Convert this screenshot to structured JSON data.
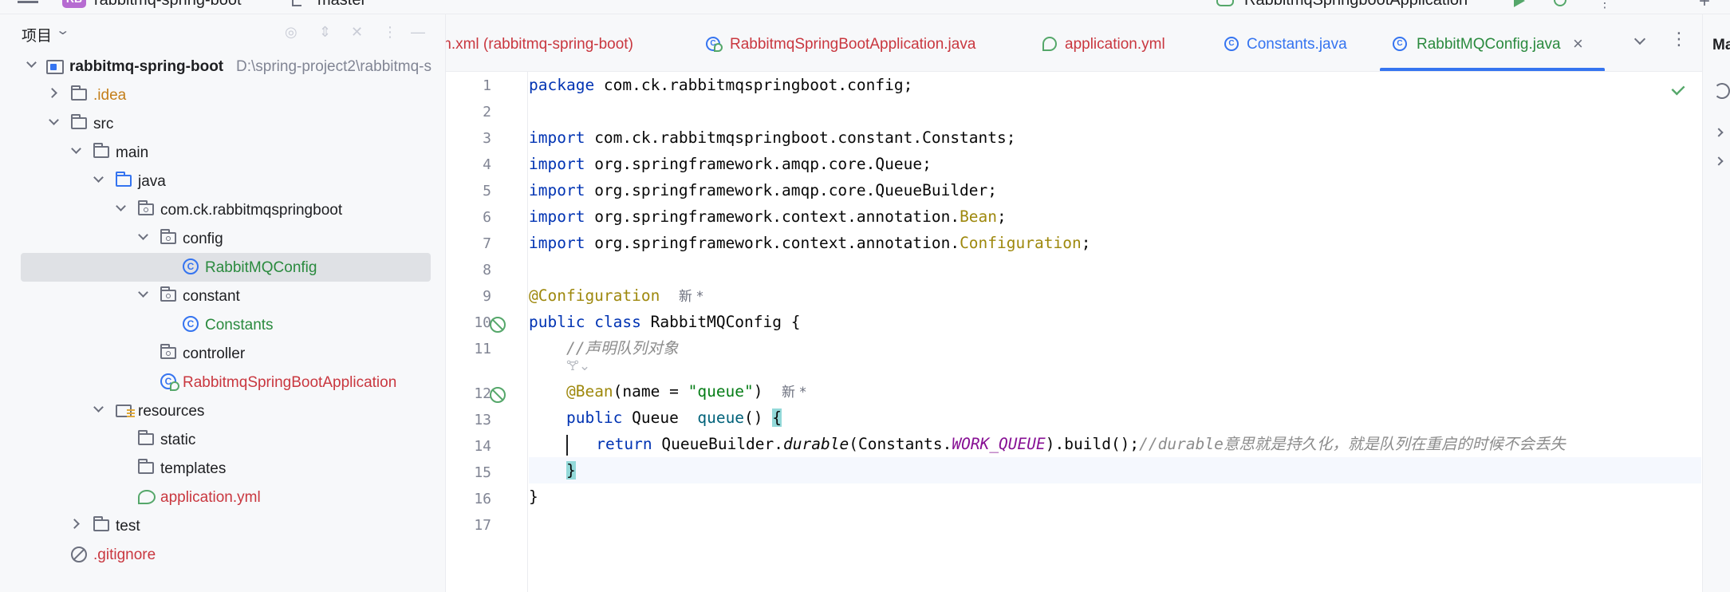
{
  "topbar": {
    "project_badge": "RB",
    "project_name": "rabbitmq-spring-boot",
    "branch": "master",
    "run_config": "RabbitmqSpringbootApplication"
  },
  "project_panel": {
    "title": "项目",
    "tree": [
      {
        "label": "rabbitmq-spring-boot",
        "path": "D:\\spring-project2\\rabbitmq-s",
        "icon": "module-icon",
        "expanded": true
      },
      {
        "label": ".idea",
        "icon": "folder-icon"
      },
      {
        "label": "src",
        "icon": "folder-icon"
      },
      {
        "label": "main",
        "icon": "folder-icon"
      },
      {
        "label": "java",
        "icon": "source-folder-icon"
      },
      {
        "label": "com.ck.rabbitmqspringboot",
        "icon": "package-icon"
      },
      {
        "label": "config",
        "icon": "package-icon"
      },
      {
        "label": "RabbitMQConfig",
        "icon": "class-icon",
        "selected": true
      },
      {
        "label": "constant",
        "icon": "package-icon"
      },
      {
        "label": "Constants",
        "icon": "class-icon"
      },
      {
        "label": "controller",
        "icon": "package-icon"
      },
      {
        "label": "RabbitmqSpringBootApplication",
        "icon": "spring-boot-class-icon"
      },
      {
        "label": "resources",
        "icon": "resources-folder-icon"
      },
      {
        "label": "static",
        "icon": "folder-icon"
      },
      {
        "label": "templates",
        "icon": "folder-icon"
      },
      {
        "label": "application.yml",
        "icon": "yaml-icon"
      },
      {
        "label": "test",
        "icon": "folder-icon"
      },
      {
        "label": ".gitignore",
        "icon": "ignore-file-icon"
      }
    ]
  },
  "tabs": [
    {
      "label": "m.xml (rabbitmq-spring-boot)"
    },
    {
      "label": "RabbitmqSpringBootApplication.java"
    },
    {
      "label": "application.yml"
    },
    {
      "label": "Constants.java"
    },
    {
      "label": "RabbitMQConfig.java",
      "active": true,
      "close": "×"
    }
  ],
  "editor": {
    "line_numbers": [
      "1",
      "2",
      "3",
      "4",
      "5",
      "6",
      "7",
      "8",
      "9",
      "10",
      "11",
      "12",
      "13",
      "14",
      "15",
      "16",
      "17"
    ],
    "tokens": {
      "package_kw": "package",
      "package_name": " com.ck.rabbitmqspringboot.config;",
      "import_kw": "import",
      "import1": " com.ck.rabbitmqspringboot.constant.Constants;",
      "import2": " org.springframework.amqp.core.Queue;",
      "import3": " org.springframework.amqp.core.QueueBuilder;",
      "import4_pre": " org.springframework.context.annotation.",
      "import4_ann": "Bean",
      "import5_pre": " org.springframework.context.annotation.",
      "import5_ann": "Configuration",
      "semicolon": ";",
      "class_ann": "@Configuration",
      "hint_new": "新 *",
      "public_kw": "public",
      "class_kw": "class",
      "class_name": " RabbitMQConfig ",
      "open_brace": "{",
      "comment_declare": "//声明队列对象",
      "ai_glyph": "🝖⌄",
      "bean_ann": "@Bean",
      "bean_args_pre": "(name = ",
      "bean_args_str": "\"queue\"",
      "bean_args_post": ")",
      "queue_type": " Queue  ",
      "queue_method": "queue",
      "parens_open": "() ",
      "return_kw": "return",
      "builder_pre": " QueueBuilder.",
      "builder_durable": "durable",
      "builder_args_pre": "(Constants.",
      "builder_const": "WORK_QUEUE",
      "builder_post": ").build();",
      "builder_comment": "//durable意思就是持久化，就是队列在重启的时候不会丢失",
      "close_brace": "}"
    }
  },
  "right_strip": {
    "title": "Ma"
  },
  "colors": {
    "keyword": "#0033b3",
    "annotation": "#9e880d",
    "string": "#067d17",
    "constant": "#871094",
    "comment": "#8c8c8c",
    "accent": "#3574f0",
    "selection": "#dfe1e5"
  }
}
